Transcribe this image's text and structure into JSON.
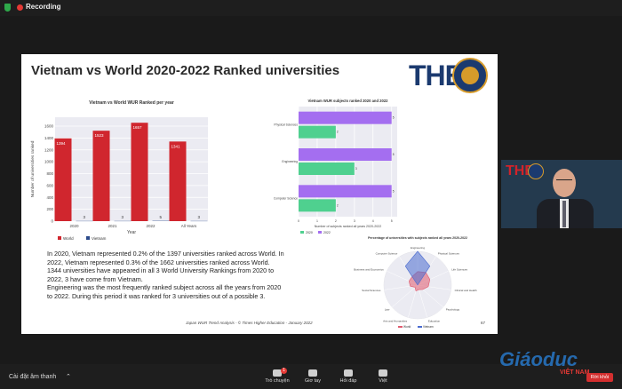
{
  "recording": {
    "label": "Recording"
  },
  "slide": {
    "title": "Vietnam vs World 2020-2022 Ranked universities",
    "logo_text": "THE",
    "body": [
      "In 2020, Vietnam represented 0.2% of the 1397 universities ranked across World. In 2022, Vietnam represented 0.3% of the 1662 universities ranked across World.",
      "1344 universities have appeared in all 3 World University Rankings from 2020 to 2022, 3 have come from Vietnam.",
      "Engineering was the most frequently ranked subject across all the years from 2020 to 2022. During this period it was ranked for 3 universities out of a possible 3."
    ],
    "footer": "Japan WUR Trend Analysis  -  © Times Higher Education - January 2022",
    "page_number": "67"
  },
  "chart_data": [
    {
      "type": "bar",
      "title": "Vietnam vs World WUR Ranked per year",
      "categories": [
        "2020",
        "2021",
        "2022",
        "All Years"
      ],
      "series": [
        {
          "name": "World",
          "values": [
            1394,
            1523,
            1657,
            1341
          ],
          "color": "#d0262e"
        },
        {
          "name": "Vietnam",
          "values": [
            3,
            3,
            5,
            3
          ],
          "color": "#2b4a8a"
        }
      ],
      "xlabel": "Year",
      "ylabel": "Number of universities ranked",
      "yticks": [
        0,
        200,
        400,
        600,
        800,
        1000,
        1200,
        1400,
        1600
      ],
      "ylim": [
        0,
        1750
      ],
      "grid": true,
      "legend": "bottom-left"
    },
    {
      "type": "bar",
      "orientation": "horizontal",
      "title": "Vietnam WUR subjects ranked 2020 and 2022",
      "categories": [
        "Physical Sciences",
        "Engineering",
        "Computer Science"
      ],
      "series": [
        {
          "name": "2020",
          "values": [
            2,
            3,
            2
          ],
          "color": "#4fd08f"
        },
        {
          "name": "2022",
          "values": [
            5,
            5,
            5
          ],
          "color": "#a46ef0"
        }
      ],
      "xlabel": "Number of subjects ranked all years  2020-2022",
      "xticks": [
        0,
        1,
        2,
        3,
        4,
        5
      ],
      "xlim": [
        0,
        5.3
      ],
      "grid": true,
      "legend": "bottom-left"
    },
    {
      "type": "radar",
      "title": "Percentage of universities with subjects ranked all years 2020-2022",
      "categories": [
        "Engineering",
        "Physical Sciences",
        "Life Sciences",
        "Clinical and Health",
        "Psychology",
        "Education",
        "Arts and Humanities",
        "Law",
        "Social Sciences",
        "Business and Economics",
        "Computer Science"
      ],
      "series": [
        {
          "name": "World",
          "values": [
            40,
            45,
            40,
            32,
            20,
            14,
            18,
            10,
            22,
            28,
            30
          ],
          "color": "#e05a6e"
        },
        {
          "name": "Vietnam",
          "values": [
            100,
            67,
            0,
            0,
            0,
            0,
            0,
            0,
            0,
            0,
            67
          ],
          "color": "#4a6bd0"
        }
      ],
      "rlim": [
        0,
        100
      ],
      "legend": "bottom"
    }
  ],
  "webcam": {
    "logo_text": "THE"
  },
  "controls": {
    "audio_label": "Cài đặt âm thanh",
    "items": [
      {
        "label": "Trò chuyện",
        "badge": "1"
      },
      {
        "label": "Giơ tay"
      },
      {
        "label": "Hỏi đáp"
      },
      {
        "label": "Việt"
      }
    ],
    "leave_label": "Rời khỏi"
  },
  "watermark": {
    "main": "Giáoduc",
    "sub": "VIỆT NAM"
  }
}
